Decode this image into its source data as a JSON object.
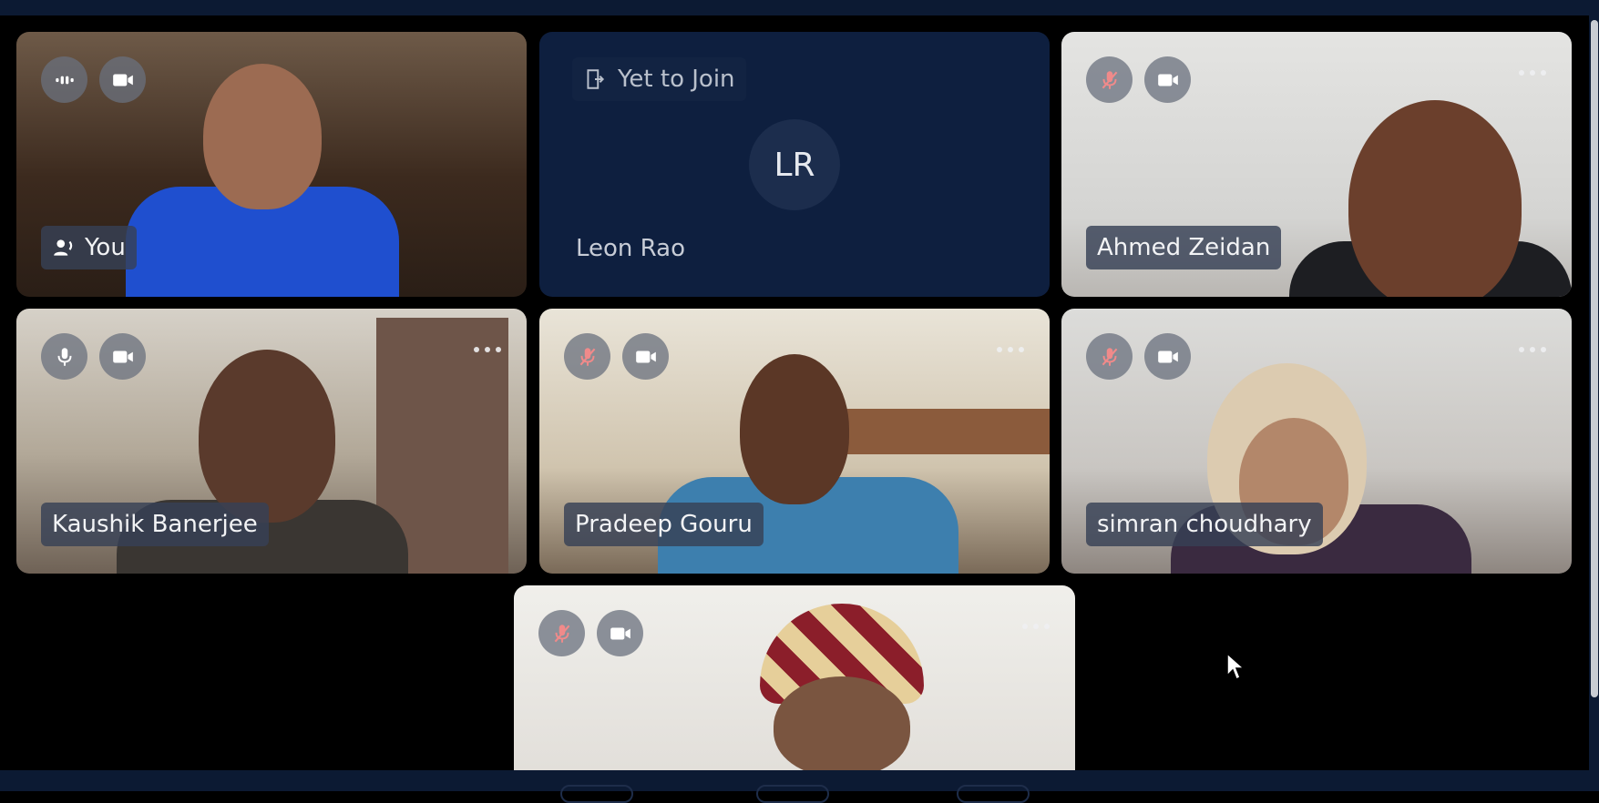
{
  "participants": {
    "you": {
      "name": "You"
    },
    "leon": {
      "status": "Yet to Join",
      "initials": "LR",
      "name": "Leon Rao"
    },
    "ahmed": {
      "name": "Ahmed Zeidan"
    },
    "kaushik": {
      "name": "Kaushik Banerjee"
    },
    "pradeep": {
      "name": "Pradeep Gouru"
    },
    "simran": {
      "name": "simran choudhary"
    },
    "bottom": {
      "name": ""
    }
  },
  "icons": {
    "mic_on": "microphone-icon",
    "mic_off": "microphone-muted-icon",
    "speaking": "audio-wave-icon",
    "camera": "video-camera-icon",
    "more": "more-options-icon",
    "speaker": "speaker-icon",
    "join": "join-door-icon"
  },
  "colors": {
    "background": "#000000",
    "bar": "#0c1a33",
    "tile_dark": "#0e1f3f",
    "muted_mic": "#f08a8a",
    "badge": "#374155"
  }
}
